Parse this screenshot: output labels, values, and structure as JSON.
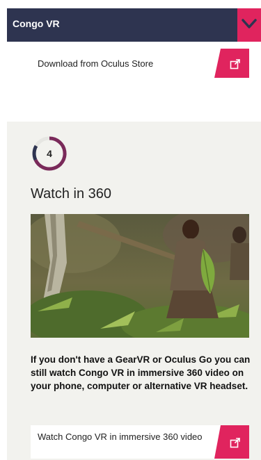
{
  "header": {
    "title": "Congo VR"
  },
  "oculus_cta": {
    "label": "Download from Oculus Store"
  },
  "step": {
    "number": "4"
  },
  "section": {
    "title": "Watch in 360"
  },
  "description": "If you don't have a GearVR or Oculus Go you can still watch Congo VR in immersive 360 video on your phone, computer or alternative VR headset.",
  "watch_cta": {
    "label": "Watch Congo VR in immersive 360 video"
  },
  "colors": {
    "header_bg": "#2e3450",
    "accent": "#e0245e",
    "panel_bg": "#f2f2ee"
  }
}
